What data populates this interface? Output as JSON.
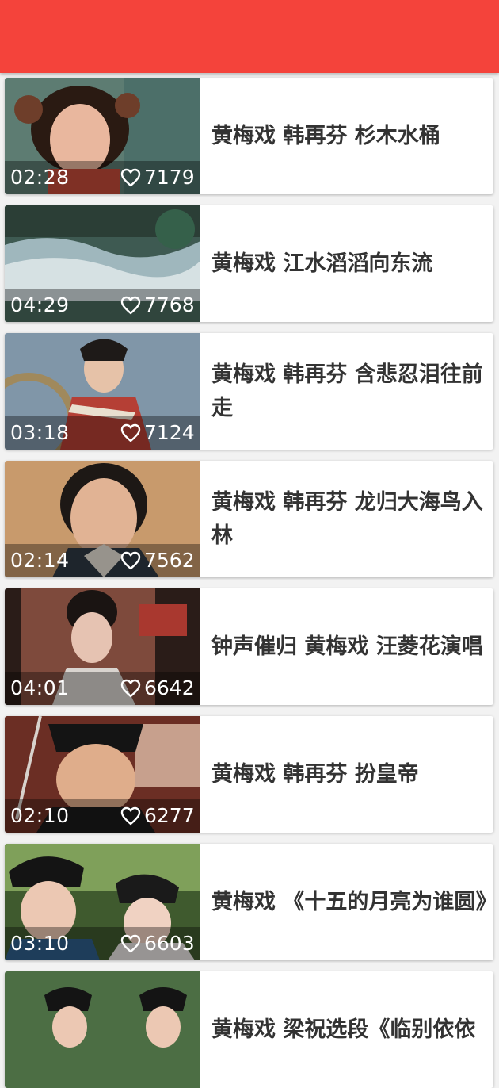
{
  "colors": {
    "toolbar": "#f4433b",
    "background": "#f2f2f2",
    "card": "#ffffff",
    "title_text": "#333333",
    "overlay_text": "#ffffff"
  },
  "icons": {
    "like": "heart-outline-icon"
  },
  "videos": [
    {
      "duration": "02:28",
      "likes": "7179",
      "title": "黄梅戏  韩再芬 杉木水桶"
    },
    {
      "duration": "04:29",
      "likes": "7768",
      "title": "黄梅戏 江水滔滔向东流"
    },
    {
      "duration": "03:18",
      "likes": "7124",
      "title": "黄梅戏  韩再芬 含悲忍泪往前走"
    },
    {
      "duration": "02:14",
      "likes": "7562",
      "title": "黄梅戏  韩再芬 龙归大海鸟入林"
    },
    {
      "duration": "04:01",
      "likes": "6642",
      "title": "钟声催归 黄梅戏 汪菱花演唱"
    },
    {
      "duration": "02:10",
      "likes": "6277",
      "title": "黄梅戏 韩再芬 扮皇帝"
    },
    {
      "duration": "03:10",
      "likes": "6603",
      "title": "黄梅戏 《十五的月亮为谁圆》"
    },
    {
      "duration": "",
      "likes": "",
      "title": "黄梅戏 梁祝选段《临别依依"
    }
  ]
}
